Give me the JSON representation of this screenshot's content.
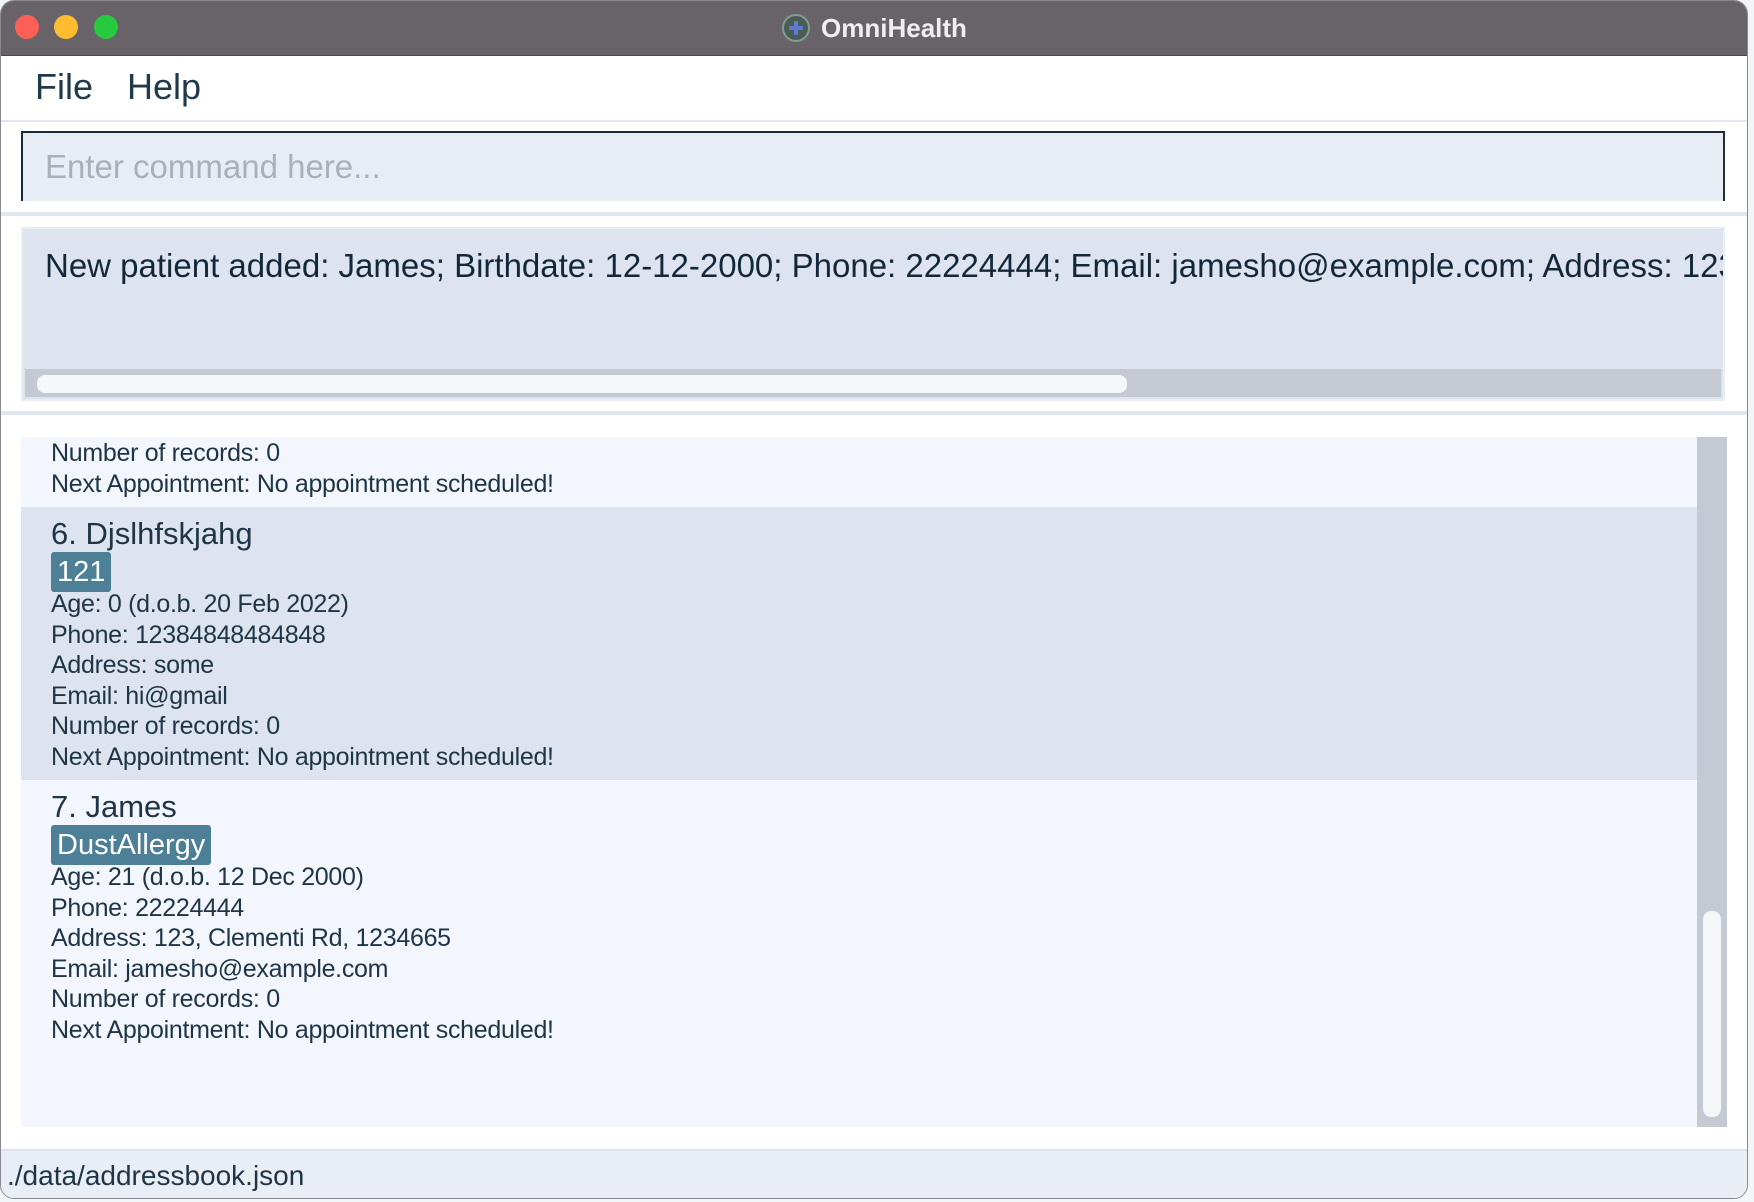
{
  "window": {
    "title": "OmniHealth"
  },
  "menu": {
    "file": "File",
    "help": "Help"
  },
  "command": {
    "placeholder": "Enter command here...",
    "value": ""
  },
  "result": {
    "text": "New patient added: James; Birthdate: 12-12-2000; Phone: 22224444; Email: jamesho@example.com; Address: 123"
  },
  "patients": {
    "partial": {
      "records": "Number of records: 0",
      "appointment": "Next Appointment: No appointment scheduled!"
    },
    "p6": {
      "name": "6.  Djslhfskjahg",
      "tag": "121",
      "age": "Age: 0   (d.o.b. 20 Feb 2022)",
      "phone": "Phone: 12384848484848",
      "address": "Address: some",
      "email": "Email: hi@gmail",
      "records": "Number of records: 0",
      "appointment": "Next Appointment: No appointment scheduled!"
    },
    "p7": {
      "name": "7.  James",
      "tag": "DustAllergy",
      "age": "Age: 21   (d.o.b. 12 Dec 2000)",
      "phone": "Phone: 22224444",
      "address": "Address: 123, Clementi Rd, 1234665",
      "email": "Email: jamesho@example.com",
      "records": "Number of records: 0",
      "appointment": "Next Appointment: No appointment scheduled!"
    }
  },
  "status": {
    "file_path": "./data/addressbook.json"
  },
  "colors": {
    "title_bar": "#686369",
    "tag_background": "#4d8097",
    "selected_card": "#dde3ef",
    "panel_background": "#f3f6fc"
  }
}
